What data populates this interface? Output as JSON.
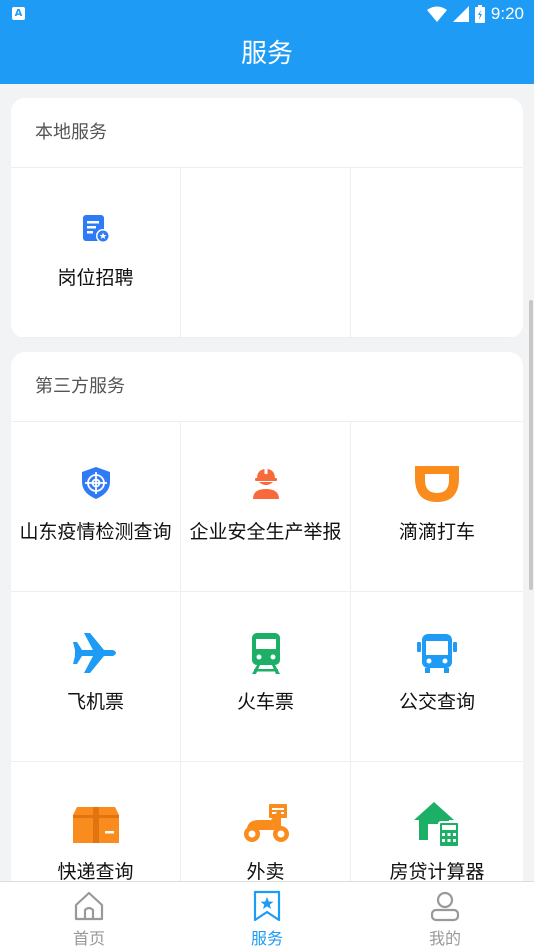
{
  "status_bar": {
    "time": "9:20",
    "app_indicator": "A"
  },
  "header": {
    "title": "服务"
  },
  "local_section": {
    "title": "本地服务",
    "items": [
      {
        "label": "岗位招聘",
        "icon": "job-posting-icon",
        "color": "#2f7bf5"
      }
    ]
  },
  "third_party_section": {
    "title": "第三方服务",
    "items": [
      {
        "label": "山东疫情检测查询",
        "icon": "shield-target-icon",
        "color": "#2f7bf5"
      },
      {
        "label": "企业安全生产举报",
        "icon": "safety-worker-icon",
        "color": "#f86a3c"
      },
      {
        "label": "滴滴打车",
        "icon": "didi-logo-icon",
        "color": "#fa8c1e"
      },
      {
        "label": "飞机票",
        "icon": "airplane-icon",
        "color": "#1e9bf5"
      },
      {
        "label": "火车票",
        "icon": "train-icon",
        "color": "#1cb066"
      },
      {
        "label": "公交查询",
        "icon": "bus-icon",
        "color": "#1e9bf5"
      },
      {
        "label": "快递查询",
        "icon": "package-icon",
        "color": "#fa8c1e"
      },
      {
        "label": "外卖",
        "icon": "scooter-icon",
        "color": "#fa8c1e"
      },
      {
        "label": "房贷计算器",
        "icon": "house-calculator-icon",
        "color": "#1cb066"
      }
    ]
  },
  "tab_bar": {
    "tabs": [
      {
        "label": "首页",
        "icon": "home-icon",
        "active": false
      },
      {
        "label": "服务",
        "icon": "bookmark-star-icon",
        "active": true
      },
      {
        "label": "我的",
        "icon": "user-icon",
        "active": false
      }
    ]
  },
  "colors": {
    "primary": "#1e9bf5",
    "inactive": "#999999"
  }
}
